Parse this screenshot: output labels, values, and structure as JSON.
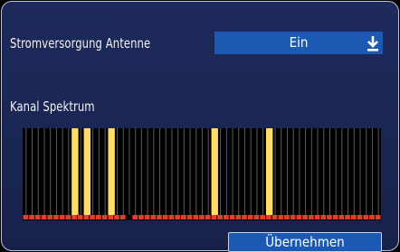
{
  "settings": {
    "power_label": "Stromversorgung Antenne",
    "power_value": "Ein",
    "spectrum_label": "Kanal Spektrum"
  },
  "actions": {
    "apply_label": "Übernehmen"
  },
  "colors": {
    "background": "#1a2552",
    "accent": "#1c59b3",
    "channel_active": "#ffdd66",
    "signal_bar": "#e0402a"
  },
  "spectrum": {
    "channel_count": 59,
    "active_channels": [
      8,
      10,
      14,
      31,
      40
    ],
    "signal_missing_channels": [
      17
    ]
  }
}
